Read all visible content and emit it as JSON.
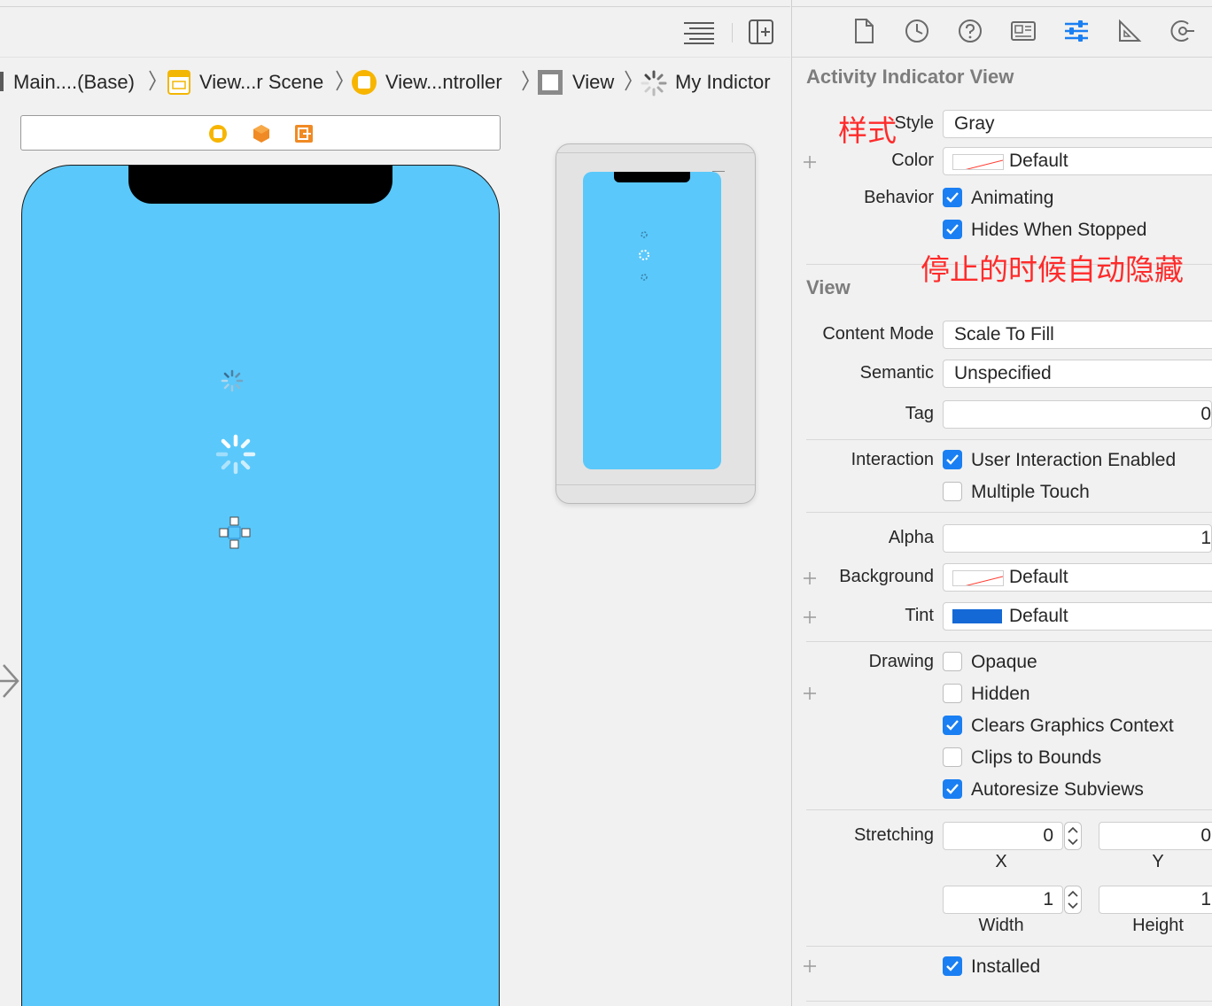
{
  "breadcrumb": {
    "items": [
      {
        "label": "Main....(Base)",
        "icon": "storyboard-file-icon"
      },
      {
        "label": "View...r Scene",
        "icon": "scene-icon"
      },
      {
        "label": "View...ntroller",
        "icon": "view-controller-icon"
      },
      {
        "label": "View",
        "icon": "view-icon"
      },
      {
        "label": "My Indictor",
        "icon": "activity-indicator-icon"
      }
    ]
  },
  "editor_toolbar": {
    "icons": [
      "editor-options-icon",
      "add-editor-icon"
    ]
  },
  "inspector": {
    "tabs": [
      "file-inspector-icon",
      "history-inspector-icon",
      "quick-help-icon",
      "identity-inspector-icon",
      "attributes-inspector-icon",
      "size-inspector-icon",
      "connections-inspector-icon"
    ],
    "activity_section": {
      "title": "Activity Indicator View",
      "style_label": "Style",
      "style_value": "Gray",
      "color_label": "Color",
      "color_value": "Default",
      "behavior_label": "Behavior",
      "animating": "Animating",
      "hides_when_stopped": "Hides When Stopped"
    },
    "view_section": {
      "title": "View",
      "content_mode_label": "Content Mode",
      "content_mode_value": "Scale To Fill",
      "semantic_label": "Semantic",
      "semantic_value": "Unspecified",
      "tag_label": "Tag",
      "tag_value": "0",
      "interaction_label": "Interaction",
      "user_interaction": "User Interaction Enabled",
      "multiple_touch": "Multiple Touch",
      "alpha_label": "Alpha",
      "alpha_value": "1",
      "background_label": "Background",
      "background_value": "Default",
      "tint_label": "Tint",
      "tint_value": "Default",
      "drawing_label": "Drawing",
      "opaque": "Opaque",
      "hidden": "Hidden",
      "clears_graphics": "Clears Graphics Context",
      "clips_to_bounds": "Clips to Bounds",
      "autoresize": "Autoresize Subviews",
      "stretching_label": "Stretching",
      "stretch_x_value": "0",
      "stretch_y_value": "0",
      "x_caption": "X",
      "y_caption": "Y",
      "stretch_w_value": "1",
      "stretch_h_value": "1",
      "width_caption": "Width",
      "height_caption": "Height",
      "installed": "Installed"
    },
    "annotations": {
      "style_note": "样式",
      "hides_note": "停止的时候自动隐藏"
    }
  },
  "checkbox_states": {
    "animating": true,
    "hides_when_stopped": true,
    "user_interaction": true,
    "multiple_touch": false,
    "opaque": false,
    "hidden": false,
    "clears_graphics": true,
    "clips_to_bounds": false,
    "autoresize": true,
    "installed": true
  },
  "colors": {
    "canvas_view": "#5ac8fa",
    "checkbox_on": "#1a7ff2",
    "tint": "#1569d6",
    "annotation": "#ff2b2b"
  }
}
